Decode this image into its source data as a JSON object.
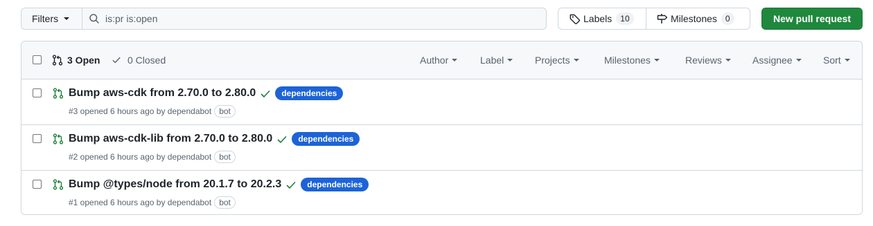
{
  "toolbar": {
    "filters_label": "Filters",
    "search_value": "is:pr is:open",
    "labels_label": "Labels",
    "labels_count": "10",
    "milestones_label": "Milestones",
    "milestones_count": "0",
    "new_pr_label": "New pull request"
  },
  "list_header": {
    "open_label": "3 Open",
    "closed_label": "0 Closed",
    "filters": [
      "Author",
      "Label",
      "Projects",
      "Milestones",
      "Reviews",
      "Assignee",
      "Sort"
    ]
  },
  "pull_requests": [
    {
      "title": "Bump aws-cdk from 2.70.0 to 2.80.0",
      "label": "dependencies",
      "meta": "#3 opened 6 hours ago by dependabot",
      "badge": "bot"
    },
    {
      "title": "Bump aws-cdk-lib from 2.70.0 to 2.80.0",
      "label": "dependencies",
      "meta": "#2 opened 6 hours ago by dependabot",
      "badge": "bot"
    },
    {
      "title": "Bump @types/node from 20.1.7 to 20.2.3",
      "label": "dependencies",
      "meta": "#1 opened 6 hours ago by dependabot",
      "badge": "bot"
    }
  ],
  "colors": {
    "open_green": "#1a7f37",
    "check_green": "#1a7f37",
    "primary_button": "#1f883d",
    "label_blue": "#1d63d8"
  },
  "icons": {
    "search": "search-icon",
    "tag": "tag-icon",
    "milestone": "milestone-icon",
    "pull_request": "git-pull-request-icon",
    "check": "check-icon"
  }
}
